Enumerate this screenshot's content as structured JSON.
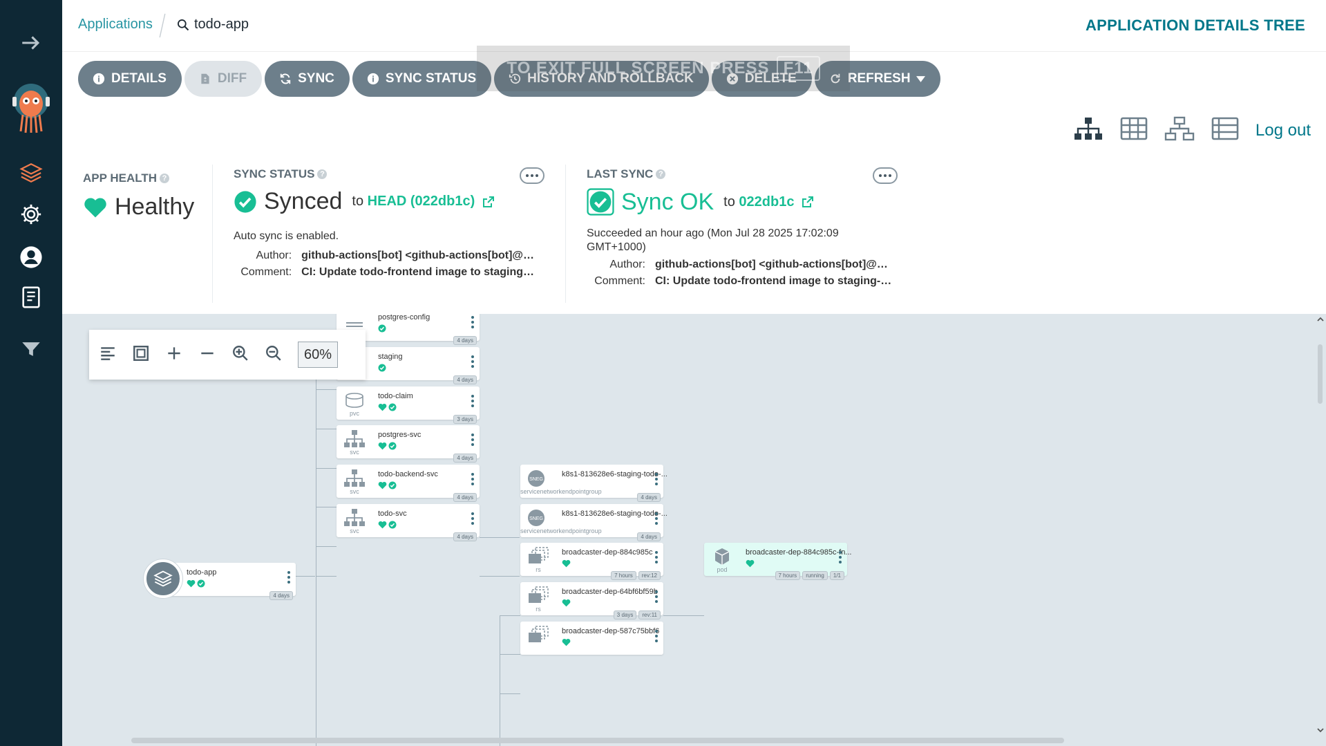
{
  "breadcrumb": {
    "root": "Applications",
    "current": "todo-app"
  },
  "page_title": "APPLICATION DETAILS TREE",
  "actions": [
    {
      "label": "DETAILS",
      "icon": "info-icon",
      "disabled": false
    },
    {
      "label": "DIFF",
      "icon": "file-diff-icon",
      "disabled": true
    },
    {
      "label": "SYNC",
      "icon": "sync-icon",
      "disabled": false
    },
    {
      "label": "SYNC STATUS",
      "icon": "info-icon",
      "disabled": false
    },
    {
      "label": "HISTORY AND ROLLBACK",
      "icon": "history-icon",
      "disabled": false
    },
    {
      "label": "DELETE",
      "icon": "close-circle-icon",
      "disabled": false
    },
    {
      "label": "REFRESH",
      "icon": "refresh-icon",
      "disabled": false
    }
  ],
  "fullscreen_hint": {
    "text": "TO EXIT FULL SCREEN PRESS",
    "key": "F11"
  },
  "logout": "Log out",
  "app_health": {
    "label": "APP HEALTH",
    "value": "Healthy"
  },
  "sync_status": {
    "label": "SYNC STATUS",
    "value": "Synced",
    "to": "to",
    "revision": "HEAD (022db1c)",
    "auto_sync": "Auto sync is enabled.",
    "author_label": "Author:",
    "author": "github-actions[bot] <github-actions[bot]@us...",
    "comment_label": "Comment:",
    "comment": "CI: Update todo-frontend image to staging-0..."
  },
  "last_sync": {
    "label": "LAST SYNC",
    "value": "Sync OK",
    "to": "to",
    "revision": "022db1c",
    "succeeded": "Succeeded an hour ago (Mon Jul 28 2025 17:02:09 GMT+1000)",
    "author_label": "Author:",
    "author": "github-actions[bot] <github-actions[bot]@us...",
    "comment_label": "Comment:",
    "comment": "CI: Update todo-frontend image to staging-0..."
  },
  "zoom": "60%",
  "colors": {
    "sidebar": "#0e2835",
    "accent": "#00778a",
    "healthy": "#18be94",
    "button": "#6d7f8b"
  },
  "nodes": {
    "root": {
      "name": "todo-app",
      "age": "4 days"
    },
    "postgres_config": {
      "name": "postgres-config",
      "age": "4 days"
    },
    "staging": {
      "name": "staging",
      "kind": "ns",
      "age": "4 days"
    },
    "todo_claim": {
      "name": "todo-claim",
      "kind": "pvc",
      "age": "3 days"
    },
    "postgres_svc": {
      "name": "postgres-svc",
      "kind": "svc",
      "age": "4 days"
    },
    "todo_backend_svc": {
      "name": "todo-backend-svc",
      "kind": "svc",
      "age": "4 days"
    },
    "todo_svc": {
      "name": "todo-svc",
      "kind": "svc",
      "age": "4 days"
    },
    "neg1": {
      "name": "k8s1-813628e6-staging-todo-...",
      "kind": "servicenetworkendpointgroup",
      "badge": "SNEG",
      "age": "4 days"
    },
    "neg2": {
      "name": "k8s1-813628e6-staging-todo-...",
      "kind": "servicenetworkendpointgroup",
      "badge": "SNEG",
      "age": "4 days"
    },
    "rs1": {
      "name": "broadcaster-dep-884c985c",
      "kind": "rs",
      "age": "7 hours",
      "rev": "rev:12"
    },
    "rs2": {
      "name": "broadcaster-dep-64bf6bf59b",
      "kind": "rs",
      "age": "3 days",
      "rev": "rev:11"
    },
    "rs3": {
      "name": "broadcaster-dep-587c75bbf6",
      "kind": "rs"
    },
    "pod1": {
      "name": "broadcaster-dep-884c985c-fn...",
      "kind": "pod",
      "age": "7 hours",
      "state": "running",
      "ready": "1/1"
    }
  }
}
